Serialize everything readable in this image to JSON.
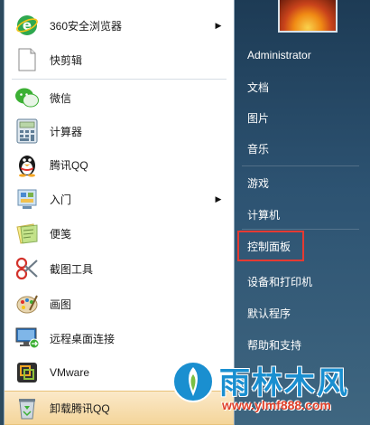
{
  "left_menu": {
    "items": [
      {
        "label": "360安全浏览器",
        "icon": "ie-browser-icon",
        "has_arrow": true
      },
      {
        "label": "快剪辑",
        "icon": "blank-document-icon",
        "has_arrow": false
      },
      {
        "label": "微信",
        "icon": "wechat-icon",
        "has_arrow": false
      },
      {
        "label": "计算器",
        "icon": "calculator-icon",
        "has_arrow": false
      },
      {
        "label": "腾讯QQ",
        "icon": "qq-penguin-icon",
        "has_arrow": false
      },
      {
        "label": "入门",
        "icon": "getting-started-icon",
        "has_arrow": true
      },
      {
        "label": "便笺",
        "icon": "sticky-notes-icon",
        "has_arrow": false
      },
      {
        "label": "截图工具",
        "icon": "snipping-tool-icon",
        "has_arrow": false
      },
      {
        "label": "画图",
        "icon": "paint-palette-icon",
        "has_arrow": false
      },
      {
        "label": "远程桌面连接",
        "icon": "remote-desktop-icon",
        "has_arrow": false
      },
      {
        "label": "VMware",
        "icon": "vmware-icon",
        "has_arrow": false
      },
      {
        "label": "卸载腾讯QQ",
        "icon": "recycle-bin-icon",
        "has_arrow": false
      }
    ],
    "arrow_glyph": "▶"
  },
  "right_menu": {
    "items": [
      {
        "label": "Administrator"
      },
      {
        "label": "文档"
      },
      {
        "label": "图片"
      },
      {
        "label": "音乐"
      },
      {
        "label": "游戏"
      },
      {
        "label": "计算机"
      },
      {
        "label": "控制面板"
      },
      {
        "label": "设备和打印机"
      },
      {
        "label": "默认程序"
      },
      {
        "label": "帮助和支持"
      }
    ]
  },
  "watermark": {
    "title": "雨林木风",
    "url": "www.ylmf888.com"
  },
  "colors": {
    "right_panel": "#2d5372",
    "highlight_box": "#e53a32",
    "hover_item": "#f4d59a",
    "watermark_title": "#1a8fd0",
    "watermark_url": "#e0402a"
  }
}
